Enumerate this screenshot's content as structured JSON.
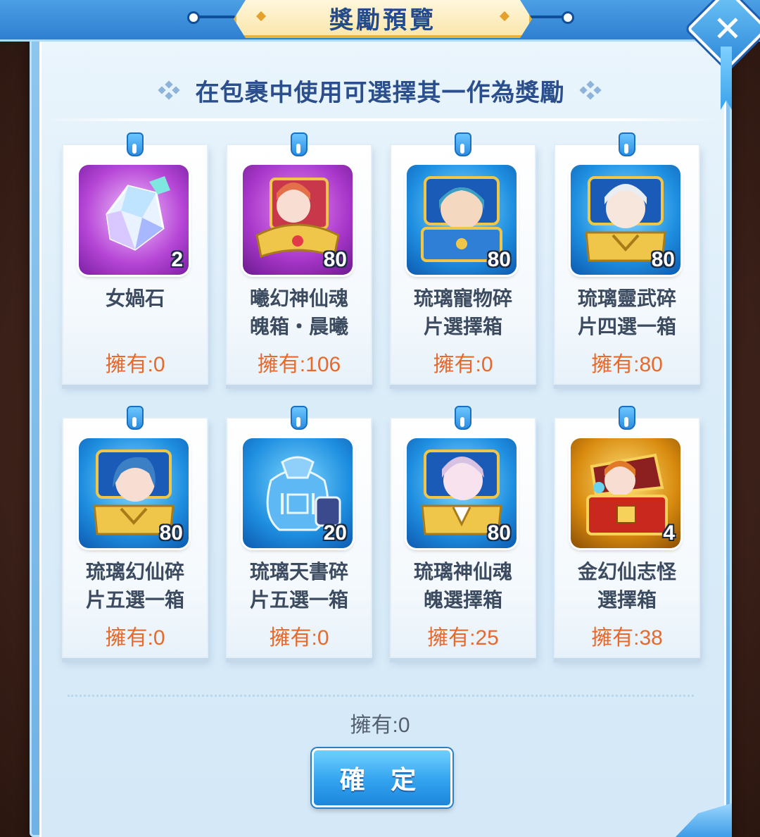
{
  "dialog": {
    "title": "獎勵預覽",
    "subtitle": "在包裹中使用可選擇其一作為獎勵",
    "close_icon": "close-icon",
    "footer_owned": "擁有:0",
    "confirm_label": "確 定"
  },
  "items": [
    {
      "name_line1": "女媧石",
      "name_line2": "",
      "count": "2",
      "owned": "擁有:0",
      "icon": "crystal-icon",
      "frame_color": "#c956e6"
    },
    {
      "name_line1": "曦幻神仙魂",
      "name_line2": "魄箱・晨曦",
      "count": "80",
      "owned": "擁有:106",
      "icon": "gold-chest-portrait-icon",
      "frame_color": "#c956e6"
    },
    {
      "name_line1": "琉璃寵物碎",
      "name_line2": "片選擇箱",
      "count": "80",
      "owned": "擁有:0",
      "icon": "blue-chest-pet-icon",
      "frame_color": "#2fa6f0"
    },
    {
      "name_line1": "琉璃靈武碎",
      "name_line2": "片四選一箱",
      "count": "80",
      "owned": "擁有:80",
      "icon": "blue-chest-portrait-icon",
      "frame_color": "#2fa6f0"
    },
    {
      "name_line1": "琉璃幻仙碎",
      "name_line2": "片五選一箱",
      "count": "80",
      "owned": "擁有:0",
      "icon": "blue-chest-portrait-icon",
      "frame_color": "#2fa6f0"
    },
    {
      "name_line1": "琉璃天書碎",
      "name_line2": "片五選一箱",
      "count": "20",
      "owned": "擁有:0",
      "icon": "blue-pouch-icon",
      "frame_color": "#2fa6f0"
    },
    {
      "name_line1": "琉璃神仙魂",
      "name_line2": "魄選擇箱",
      "count": "80",
      "owned": "擁有:25",
      "icon": "blue-chest-portrait-icon",
      "frame_color": "#2fa6f0"
    },
    {
      "name_line1": "金幻仙志怪",
      "name_line2": "選擇箱",
      "count": "4",
      "owned": "擁有:38",
      "icon": "gold-chest-icon",
      "frame_color": "#f2c21c"
    }
  ]
}
